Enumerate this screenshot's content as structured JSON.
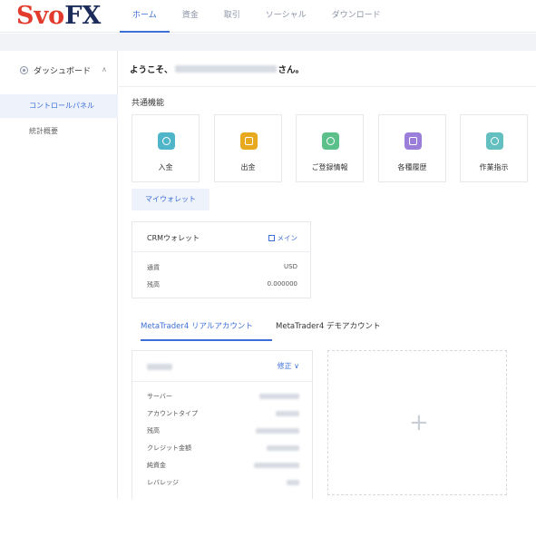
{
  "header": {
    "logo_svo": "Svo",
    "logo_fx": "FX",
    "nav": [
      "ホーム",
      "資金",
      "取引",
      "ソーシャル",
      "ダウンロード"
    ],
    "active_nav_index": 0
  },
  "sidebar": {
    "group_label": "ダッシュボード",
    "items": [
      {
        "label": "コントロールパネル",
        "active": true
      },
      {
        "label": "統計概要",
        "active": false
      }
    ]
  },
  "main": {
    "welcome_prefix": "ようこそ、",
    "welcome_suffix": "さん。",
    "section_title": "共通機能",
    "functions": [
      {
        "label": "入金",
        "icon": "deposit-icon",
        "color": "#4fb6c9"
      },
      {
        "label": "出金",
        "icon": "withdraw-icon",
        "color": "#e7aa1e"
      },
      {
        "label": "ご登録情報",
        "icon": "profile-icon",
        "color": "#5cc08a"
      },
      {
        "label": "各種履歴",
        "icon": "history-icon",
        "color": "#9b7ed9"
      },
      {
        "label": "作業指示",
        "icon": "task-icon",
        "color": "#63bfc0"
      }
    ],
    "wallet_tab": "マイウォレット",
    "crm": {
      "title": "CRMウォレット",
      "main_label": "メイン",
      "rows": [
        {
          "label": "通貨",
          "value": "USD"
        },
        {
          "label": "残高",
          "value": "0.000000"
        }
      ]
    },
    "account_tabs": [
      "MetaTrader4 リアルアカウント",
      "MetaTrader4 デモアカウント"
    ],
    "account_card": {
      "edit_label": "修正 ∨",
      "rows": [
        "サーバー",
        "アカウントタイプ",
        "残高",
        "クレジット金額",
        "純資金",
        "レバレッジ"
      ]
    },
    "add_symbol": "+"
  },
  "colors": {
    "accent": "#3d6fd9",
    "logo_red": "#e23a2c",
    "logo_navy": "#1b2c5a"
  }
}
